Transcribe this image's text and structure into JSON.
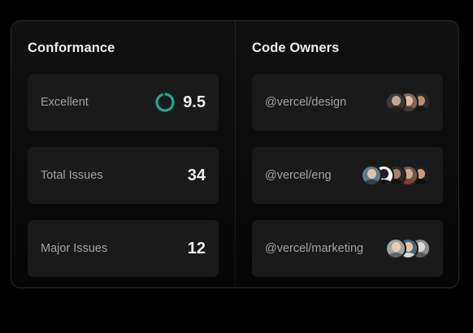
{
  "conformance": {
    "title": "Conformance",
    "score_label": "Excellent",
    "score_value": "9.5",
    "score_fraction": 0.95,
    "ring_color": "#1fa88c",
    "total_issues_label": "Total Issues",
    "total_issues_value": "34",
    "major_issues_label": "Major Issues",
    "major_issues_value": "12"
  },
  "code_owners": {
    "title": "Code Owners",
    "teams": [
      {
        "name": "@vercel/design",
        "avatars": [
          {
            "bg": "#3a3a3a",
            "head": "#c9a48a",
            "body": "#222222"
          },
          {
            "bg": "#7a6a5e",
            "head": "#e0b89a",
            "body": "#4a3c32"
          },
          {
            "bg": "#2b2b2b",
            "head": "#b98b72",
            "body": "#161616"
          }
        ]
      },
      {
        "name": "@vercel/eng",
        "avatars": [
          {
            "bg": "#5d7a8c",
            "head": "#e2c1a8",
            "body": "#32404a"
          },
          {
            "bg": "#f2f2f2",
            "head": "#1e1e1e",
            "body": "#111111"
          },
          {
            "bg": "#2a2a2a",
            "head": "#a8806a",
            "body": "#121212"
          },
          {
            "bg": "#6b5a52",
            "head": "#d4a98c",
            "body": "#8a3a2a"
          },
          {
            "bg": "#1f1f1f",
            "head": "#c79a7c",
            "body": "#0e0e0e"
          }
        ]
      },
      {
        "name": "@vercel/marketing",
        "avatars": [
          {
            "bg": "#9aa3a6",
            "head": "#e8cdb6",
            "body": "#5e6568"
          },
          {
            "bg": "#3f6b8a",
            "head": "#e6c4a6",
            "body": "#d8d8d8"
          },
          {
            "bg": "#8c8c8c",
            "head": "#d9d9d9",
            "body": "#5a5a5a"
          }
        ]
      }
    ]
  }
}
